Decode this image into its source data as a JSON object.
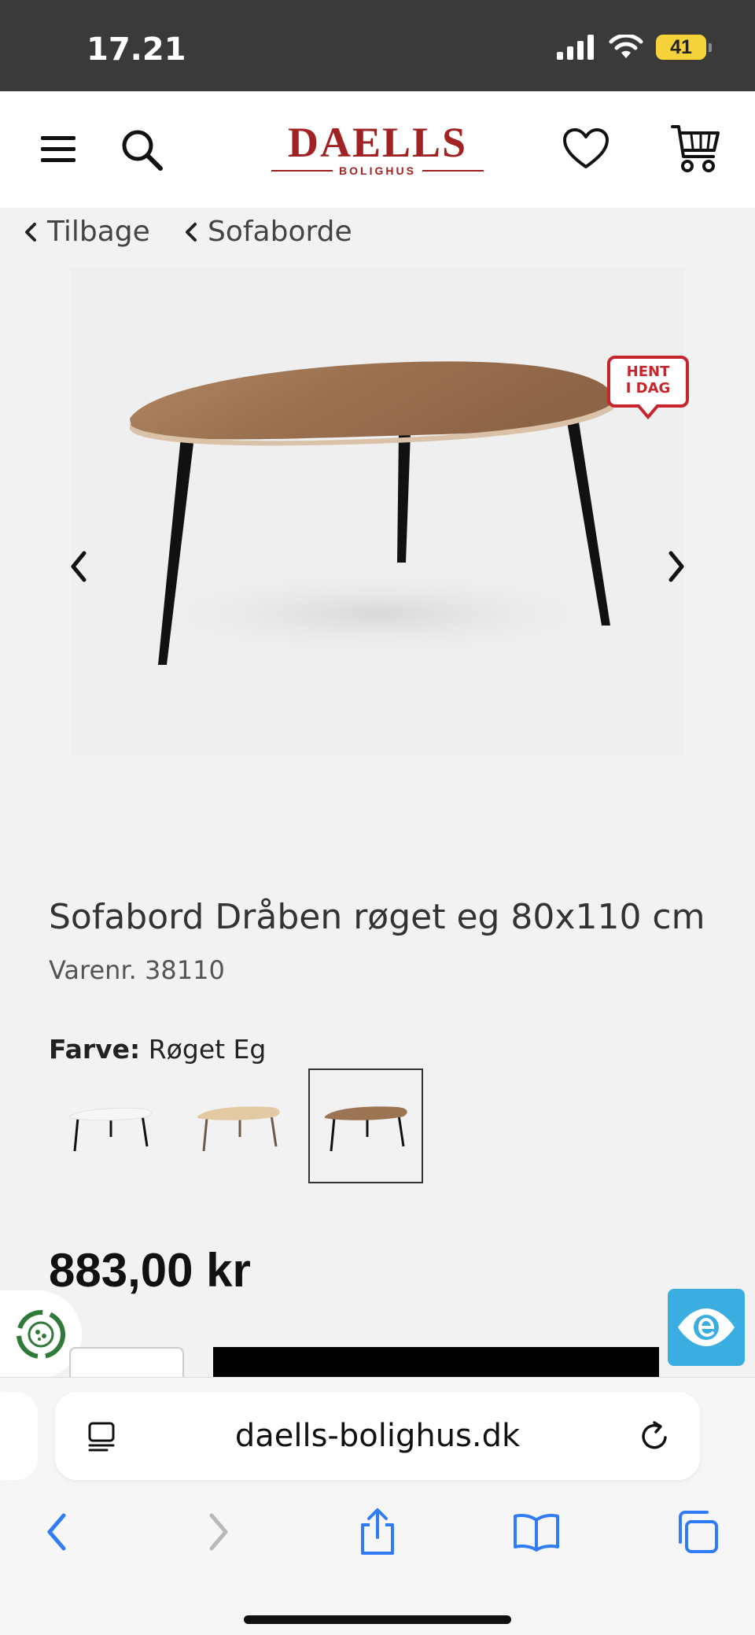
{
  "status_bar": {
    "time": "17.21",
    "battery": "41"
  },
  "header": {
    "logo_main": "DAELLS",
    "logo_sub": "BOLIGHUS"
  },
  "breadcrumb": {
    "back_label": "Tilbage",
    "category_label": "Sofaborde"
  },
  "gallery": {
    "badge_line1": "HENT",
    "badge_line2": "I DAG"
  },
  "product": {
    "title": "Sofabord Dråben røget eg 80x110 cm",
    "sku": "Varenr. 38110",
    "color_label": "Farve:",
    "color_value": "Røget Eg",
    "swatches": [
      {
        "top_color": "#f4f4f4",
        "selected": false
      },
      {
        "top_color": "#e3c9a4",
        "selected": false
      },
      {
        "top_color": "#9b7453",
        "selected": true
      }
    ],
    "price": "883,00 kr"
  },
  "browser": {
    "url": "daells-bolighus.dk"
  },
  "colors": {
    "brand": "#a12223",
    "ios_blue": "#2f7cf6",
    "accessibility": "#3aaee0"
  }
}
